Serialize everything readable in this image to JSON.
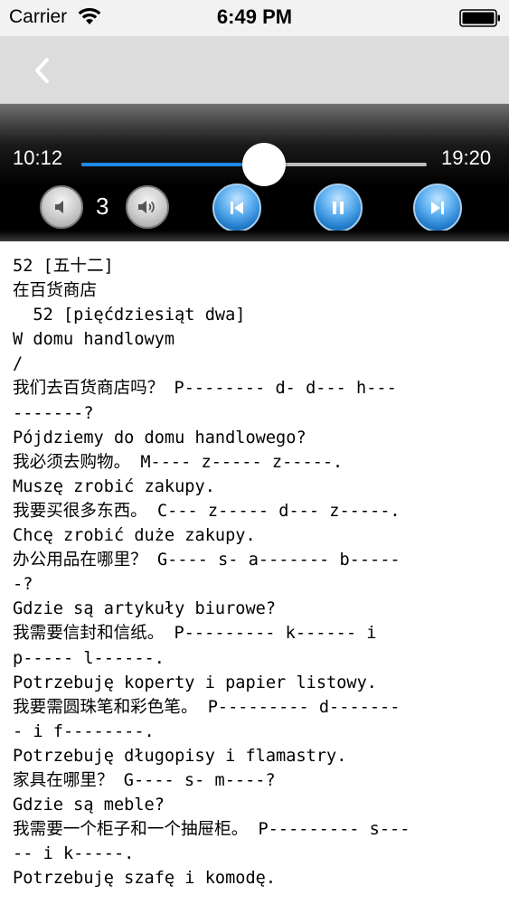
{
  "status": {
    "carrier": "Carrier",
    "time": "6:49 PM"
  },
  "player": {
    "elapsed": "10:12",
    "total": "19:20",
    "progress": 0.5276,
    "volume_level": "3",
    "accent_color": "#1e88e5"
  },
  "icons": {
    "wifi": "wifi-icon",
    "battery": "battery-icon",
    "back": "chevron-left-icon",
    "volume_down": "speaker-low-icon",
    "volume_up": "speaker-high-icon",
    "previous": "skip-previous-icon",
    "pause": "pause-icon",
    "next": "skip-next-icon"
  },
  "lesson": {
    "lines": [
      "52 [五十二]",
      "在百货商店",
      "  52 [pięćdziesiąt dwa]",
      "W domu handlowym",
      "/",
      "我们去百货商店吗？ P-------- d- d--- h---",
      "-------?",
      "Pójdziemy do domu handlowego?",
      "我必须去购物。 M---- z----- z-----.",
      "Muszę zrobić zakupy.",
      "我要买很多东西。 C--- z----- d--- z-----.",
      "Chcę zrobić duże zakupy.",
      "办公用品在哪里？ G---- s- a------- b-----",
      "-?",
      "Gdzie są artykuły biurowe?",
      "我需要信封和信纸。 P--------- k------ i",
      "p----- l------.",
      "Potrzebuję koperty i papier listowy.",
      "我要需圆珠笔和彩色笔。 P--------- d-------",
      "- i f--------.",
      "Potrzebuję długopisy i flamastry.",
      "家具在哪里？ G---- s- m----?",
      "Gdzie są meble?",
      "我需要一个柜子和一个抽屉柜。 P--------- s---",
      "-- i k-----.",
      "Potrzebuję szafę i komodę."
    ]
  }
}
